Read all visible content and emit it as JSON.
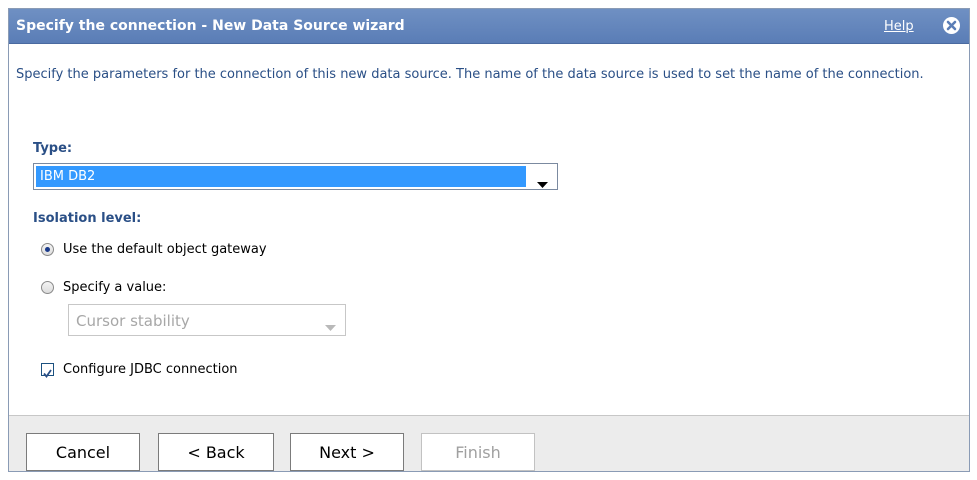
{
  "dialog": {
    "title": "Specify the connection - New Data Source wizard",
    "help_label": "Help",
    "description": "Specify the parameters for the connection of this new data source. The name of the data source is used to set the name of the connection."
  },
  "type": {
    "label": "Type:",
    "selected": "IBM DB2"
  },
  "isolation": {
    "label": "Isolation level:",
    "option_default": "Use the default object gateway",
    "option_specify": "Specify a value:",
    "selected_option": "default",
    "value_select": "Cursor stability"
  },
  "jdbc": {
    "label": "Configure JDBC connection",
    "checked": true
  },
  "buttons": {
    "cancel": "Cancel",
    "back": "< Back",
    "next": "Next >",
    "finish": "Finish"
  },
  "colors": {
    "titlebar": "#5a7db6",
    "accent_text": "#2a4f86",
    "selection": "#3399ff"
  }
}
